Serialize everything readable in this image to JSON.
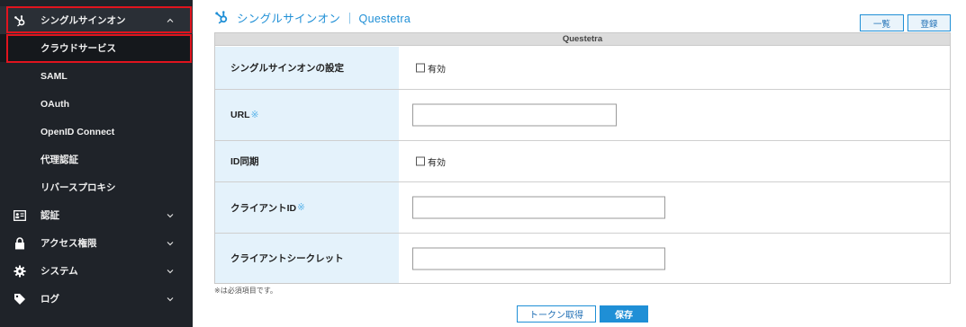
{
  "header": {
    "title": "シングルサインオン ｜ Questetra"
  },
  "top_buttons": {
    "list": "一覧",
    "register": "登録"
  },
  "sidebar": {
    "parent": {
      "label": "シングルサインオン",
      "icon": "hubspot-sso-icon",
      "state": "expanded"
    },
    "sub_items": [
      {
        "label": "クラウドサービス",
        "active": true
      },
      {
        "label": "SAML"
      },
      {
        "label": "OAuth"
      },
      {
        "label": "OpenID Connect"
      },
      {
        "label": "代理認証"
      },
      {
        "label": "リバースプロキシ"
      }
    ],
    "sections": [
      {
        "label": "認証",
        "icon": "id-card-icon"
      },
      {
        "label": "アクセス権限",
        "icon": "lock-icon"
      },
      {
        "label": "システム",
        "icon": "gear-icon"
      },
      {
        "label": "ログ",
        "icon": "tag-icon"
      }
    ]
  },
  "form": {
    "section_title": "Questetra",
    "rows": [
      {
        "label": "シングルサインオンの設定",
        "type": "checkbox",
        "option": "有効",
        "checked": false
      },
      {
        "label": "URL",
        "required_mark": "※",
        "type": "text",
        "value": ""
      },
      {
        "label": "ID同期",
        "type": "checkbox",
        "option": "有効",
        "checked": false
      },
      {
        "label": "クライアントID",
        "required_mark": "※",
        "type": "text",
        "value": ""
      },
      {
        "label": "クライアントシークレット",
        "type": "text",
        "value": ""
      }
    ]
  },
  "note": "※は必須項目です。",
  "actions": {
    "token": "トークン取得",
    "save": "保存"
  },
  "colors": {
    "accent": "#1f8fd6",
    "sidebar_bg": "#1f2329",
    "label_bg": "#e4f2fb",
    "highlight": "#e0141e"
  }
}
